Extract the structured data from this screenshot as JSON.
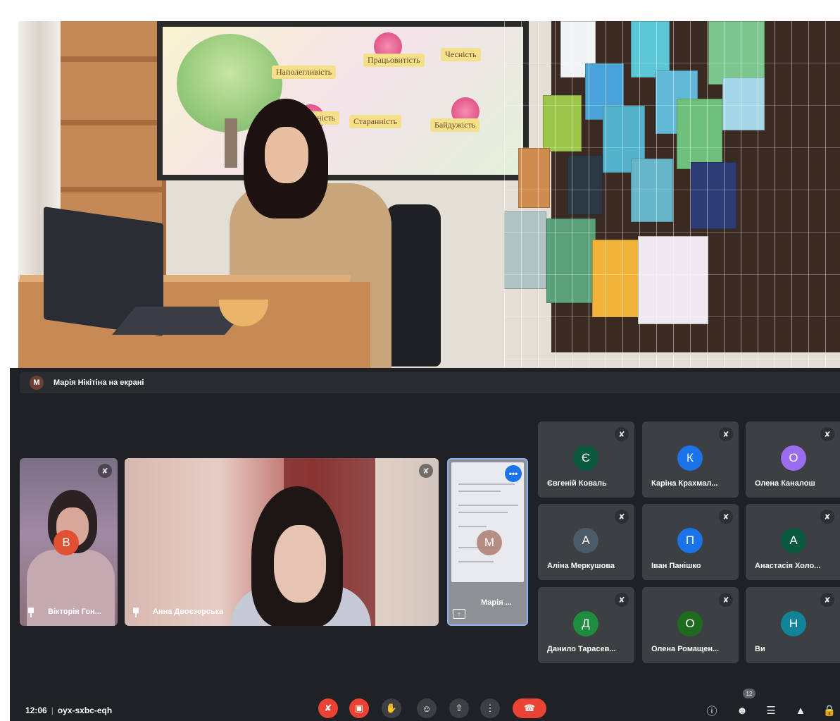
{
  "presentation_bar": {
    "avatar_letter": "M",
    "text": "Марія Нікітіна на екрані"
  },
  "screen_words": [
    "Чесність",
    "Працьовитість",
    "Наполегливість",
    "Старанність",
    "Байдужість",
    "Скромність"
  ],
  "video_tiles": [
    {
      "name": "Вікторія Гон...",
      "avatar_letter": "В",
      "avatar_color": "#e25034"
    },
    {
      "name": "Анна Двоєзерська"
    },
    {
      "name": "Марія ...",
      "avatar_letter": "М",
      "avatar_color": "#b0847a"
    }
  ],
  "participants": [
    {
      "letter": "Є",
      "name": "Євгеній Коваль",
      "color": "#0b5a3f"
    },
    {
      "letter": "К",
      "name": "Каріна Крахмал...",
      "color": "#1a73e8"
    },
    {
      "letter": "О",
      "name": "Олена Каналош",
      "color": "#9c6cf0"
    },
    {
      "letter": "А",
      "name": "Аліна Меркушова",
      "color": "#4a5b6a"
    },
    {
      "letter": "П",
      "name": "Іван Панішко",
      "color": "#1a73e8"
    },
    {
      "letter": "А",
      "name": "Анастасія Холо...",
      "color": "#0b5a3f"
    },
    {
      "letter": "Д",
      "name": "Данило Тарасев...",
      "color": "#1e8e3e"
    },
    {
      "letter": "О",
      "name": "Олена Ромащен...",
      "color": "#1e6b1e"
    },
    {
      "letter": "Н",
      "name": "Ви",
      "color": "#12849a"
    }
  ],
  "bottom_bar": {
    "time": "12:06",
    "meeting_code": "oyx-sxbc-eqh",
    "people_count": "12",
    "presenting_menu": "•••"
  },
  "icons": {
    "mic_off": "mic-off-icon",
    "cam_off": "camera-off-icon",
    "hand": "raise-hand-icon",
    "emoji": "emoji-icon",
    "present": "present-screen-icon",
    "more": "more-options-icon",
    "end": "end-call-icon",
    "info": "info-icon",
    "people": "people-icon",
    "chat": "chat-icon",
    "activities": "activities-icon",
    "lock": "host-controls-icon"
  }
}
